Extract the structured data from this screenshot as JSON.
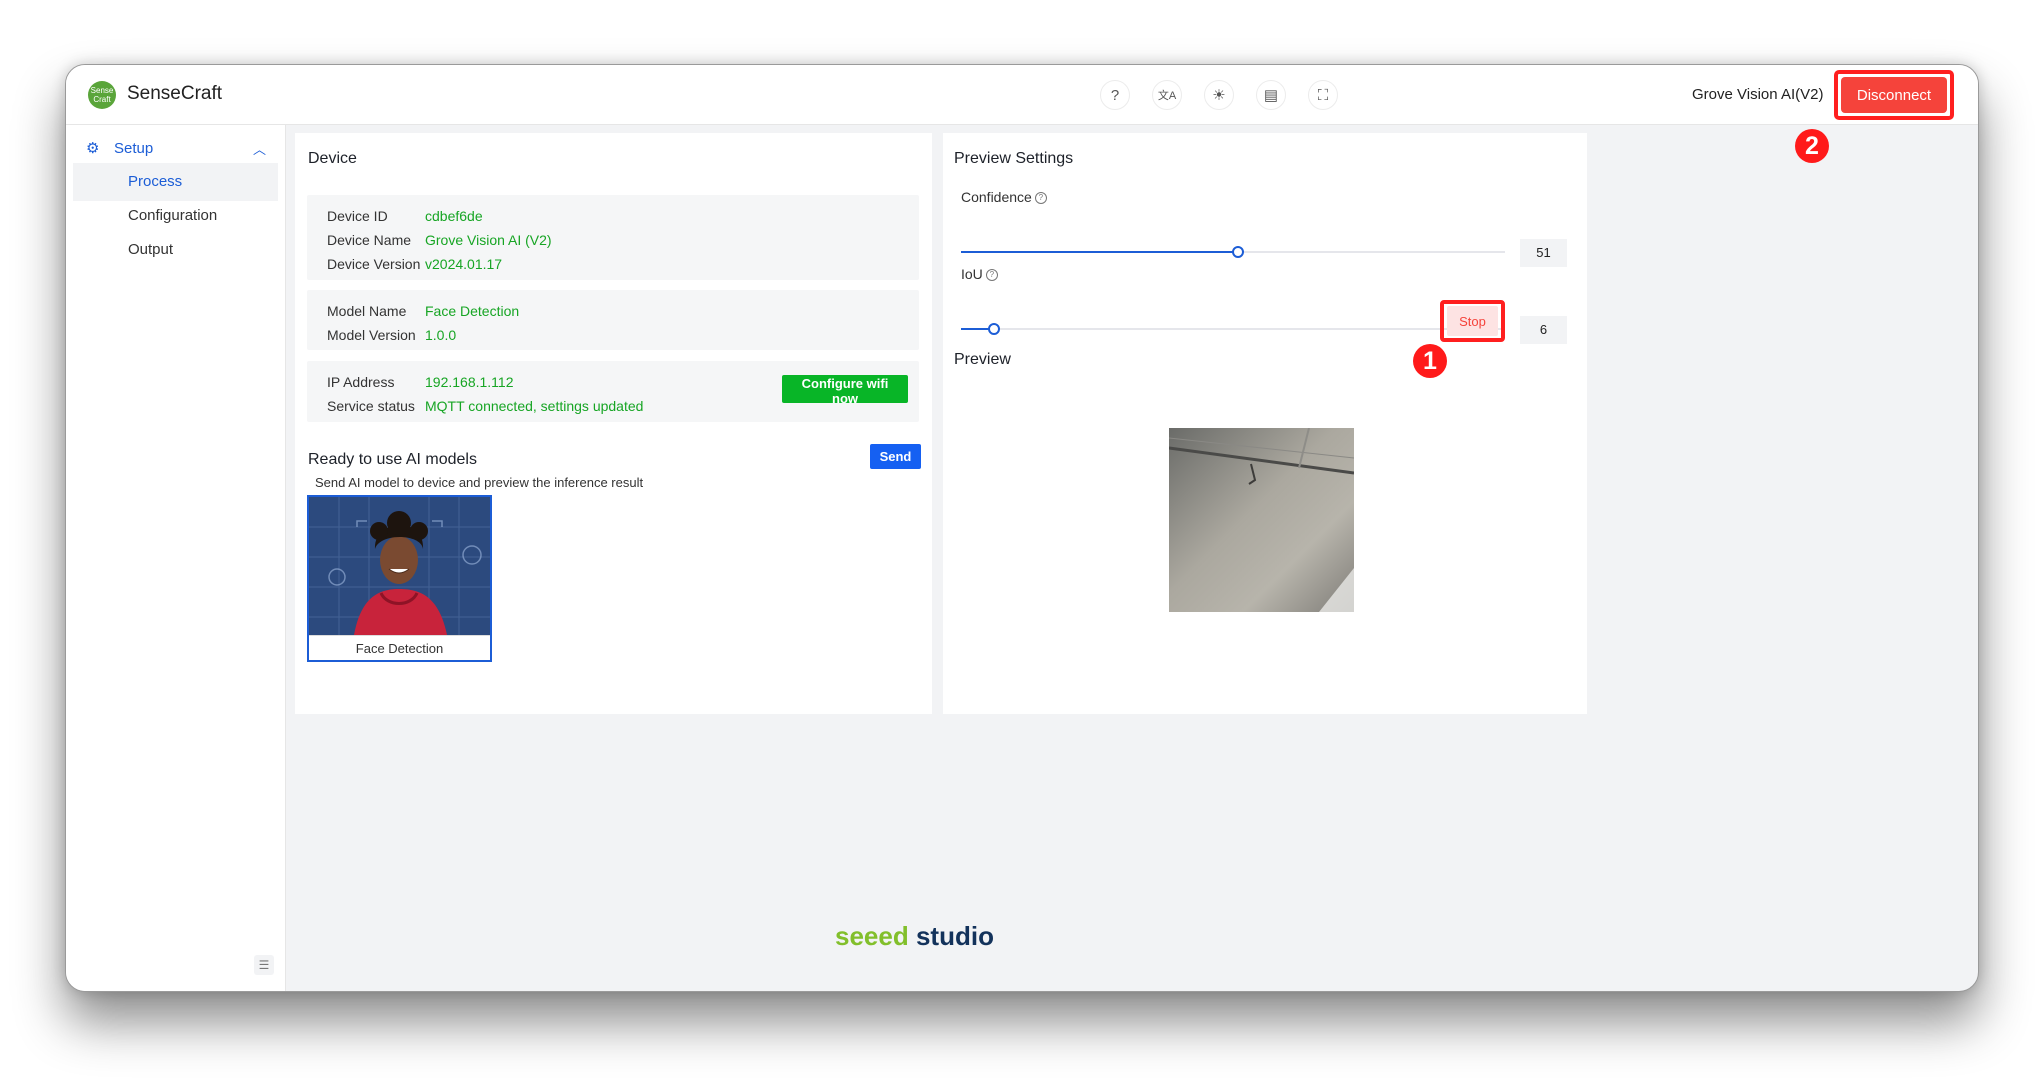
{
  "app": {
    "name": "SenseCraft",
    "logo_text": "Sense Craft"
  },
  "topbar": {
    "icons": [
      "help-icon",
      "translate-icon",
      "theme-icon",
      "document-icon",
      "fullscreen-icon"
    ],
    "icon_glyphs": {
      "help": "?",
      "translate": "文A",
      "theme": "☀",
      "document": "▤",
      "fullscreen": "⛶"
    },
    "device_name": "Grove Vision AI(V2)",
    "disconnect_label": "Disconnect"
  },
  "sidebar": {
    "section": {
      "label": "Setup"
    },
    "items": [
      {
        "label": "Process",
        "active": true
      },
      {
        "label": "Configuration",
        "active": false
      },
      {
        "label": "Output",
        "active": false
      }
    ]
  },
  "device": {
    "title": "Device",
    "info": [
      {
        "label": "Device ID",
        "value": "cdbef6de"
      },
      {
        "label": "Device Name",
        "value": "Grove Vision AI (V2)"
      },
      {
        "label": "Device Version",
        "value": "v2024.01.17"
      }
    ],
    "model": [
      {
        "label": "Model Name",
        "value": "Face Detection"
      },
      {
        "label": "Model Version",
        "value": "1.0.0"
      }
    ],
    "network": [
      {
        "label": "IP Address",
        "value": "192.168.1.112"
      },
      {
        "label": "Service status",
        "value": "MQTT connected, settings updated"
      }
    ],
    "wifi_button": "Configure wifi now"
  },
  "models": {
    "title": "Ready to use AI models",
    "subtitle": "Send AI model to device and preview the inference result",
    "send_label": "Send",
    "cards": [
      {
        "label": "Face Detection"
      }
    ]
  },
  "preview_settings": {
    "title": "Preview Settings",
    "confidence": {
      "label": "Confidence",
      "value": 51
    },
    "iou": {
      "label": "IoU",
      "value": 6
    }
  },
  "preview": {
    "title": "Preview",
    "stop_label": "Stop"
  },
  "annotations": {
    "marker_1": "1",
    "marker_2": "2"
  },
  "footer": {
    "brand_part1": "seeed",
    "brand_part2": " studio"
  },
  "colors": {
    "accent_blue": "#1c5dd6",
    "success_green": "#17a524",
    "button_green": "#08b527",
    "danger_red": "#f5433b",
    "annotation_red": "#ff1f1f",
    "send_blue": "#1560f2"
  }
}
